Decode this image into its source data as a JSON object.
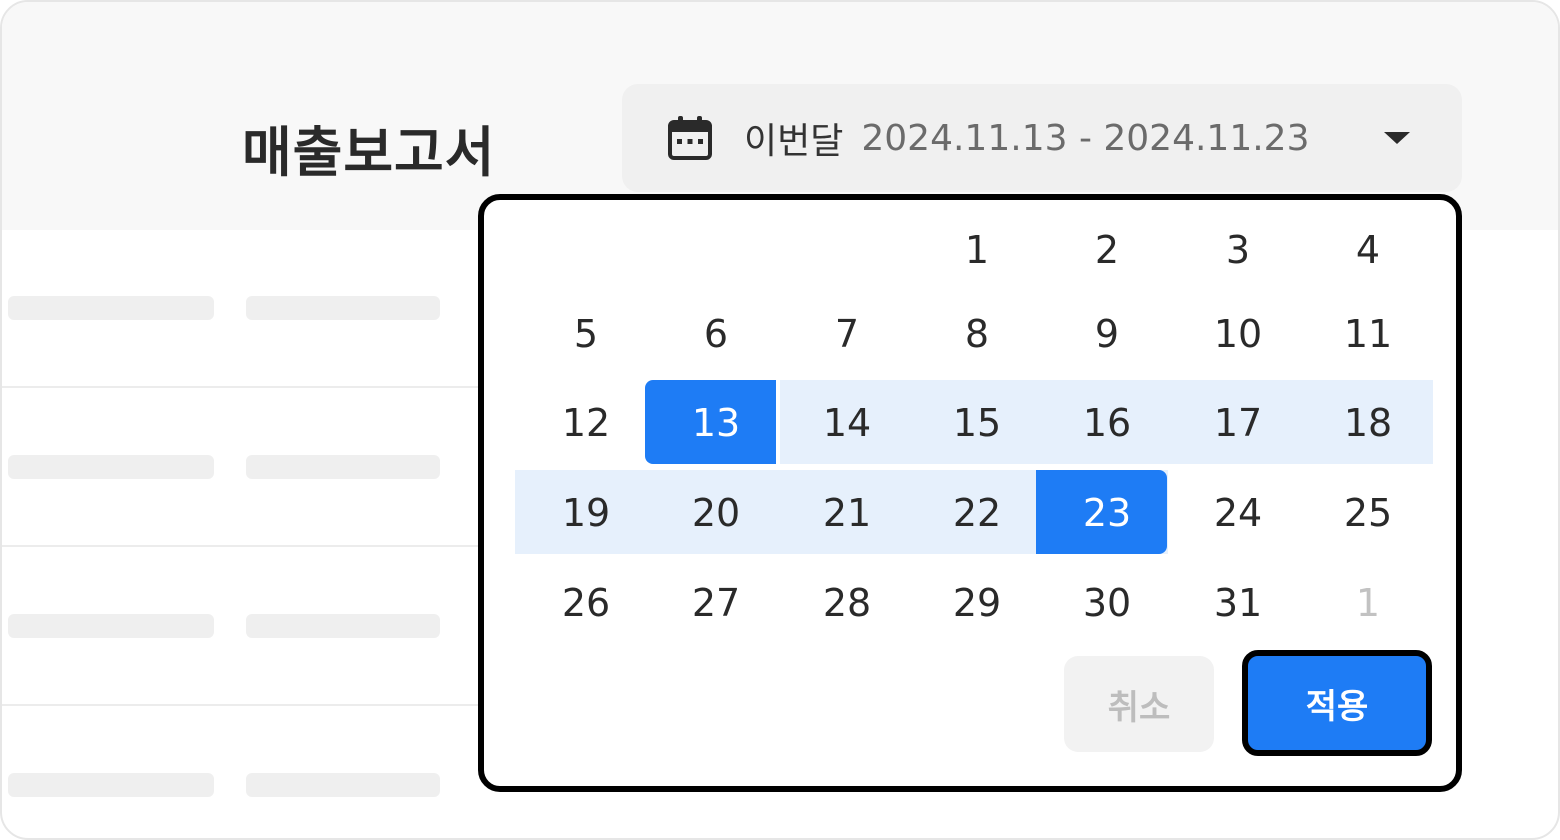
{
  "header": {
    "title": "매출보고서"
  },
  "date_picker": {
    "preset": "이번달",
    "range": "2024.11.13 - 2024.11.23",
    "icon": "calendar-icon",
    "caret_icon": "caret-down-icon"
  },
  "calendar": {
    "weeks": [
      [
        "",
        "",
        "",
        "1",
        "2",
        "3",
        "4"
      ],
      [
        "5",
        "6",
        "7",
        "8",
        "9",
        "10",
        "11"
      ],
      [
        "12",
        "13",
        "14",
        "15",
        "16",
        "17",
        "18"
      ],
      [
        "19",
        "20",
        "21",
        "22",
        "23",
        "24",
        "25"
      ],
      [
        "26",
        "27",
        "28",
        "29",
        "30",
        "31",
        "1"
      ]
    ],
    "range_start": "13",
    "range_end": "23",
    "next_month_days": [
      "1"
    ]
  },
  "actions": {
    "cancel_label": "취소",
    "apply_label": "적용"
  },
  "colors": {
    "accent": "#1e7cf5",
    "range_highlight": "#e6f0fc",
    "border": "#000000",
    "muted_text": "#c2c2c2"
  }
}
